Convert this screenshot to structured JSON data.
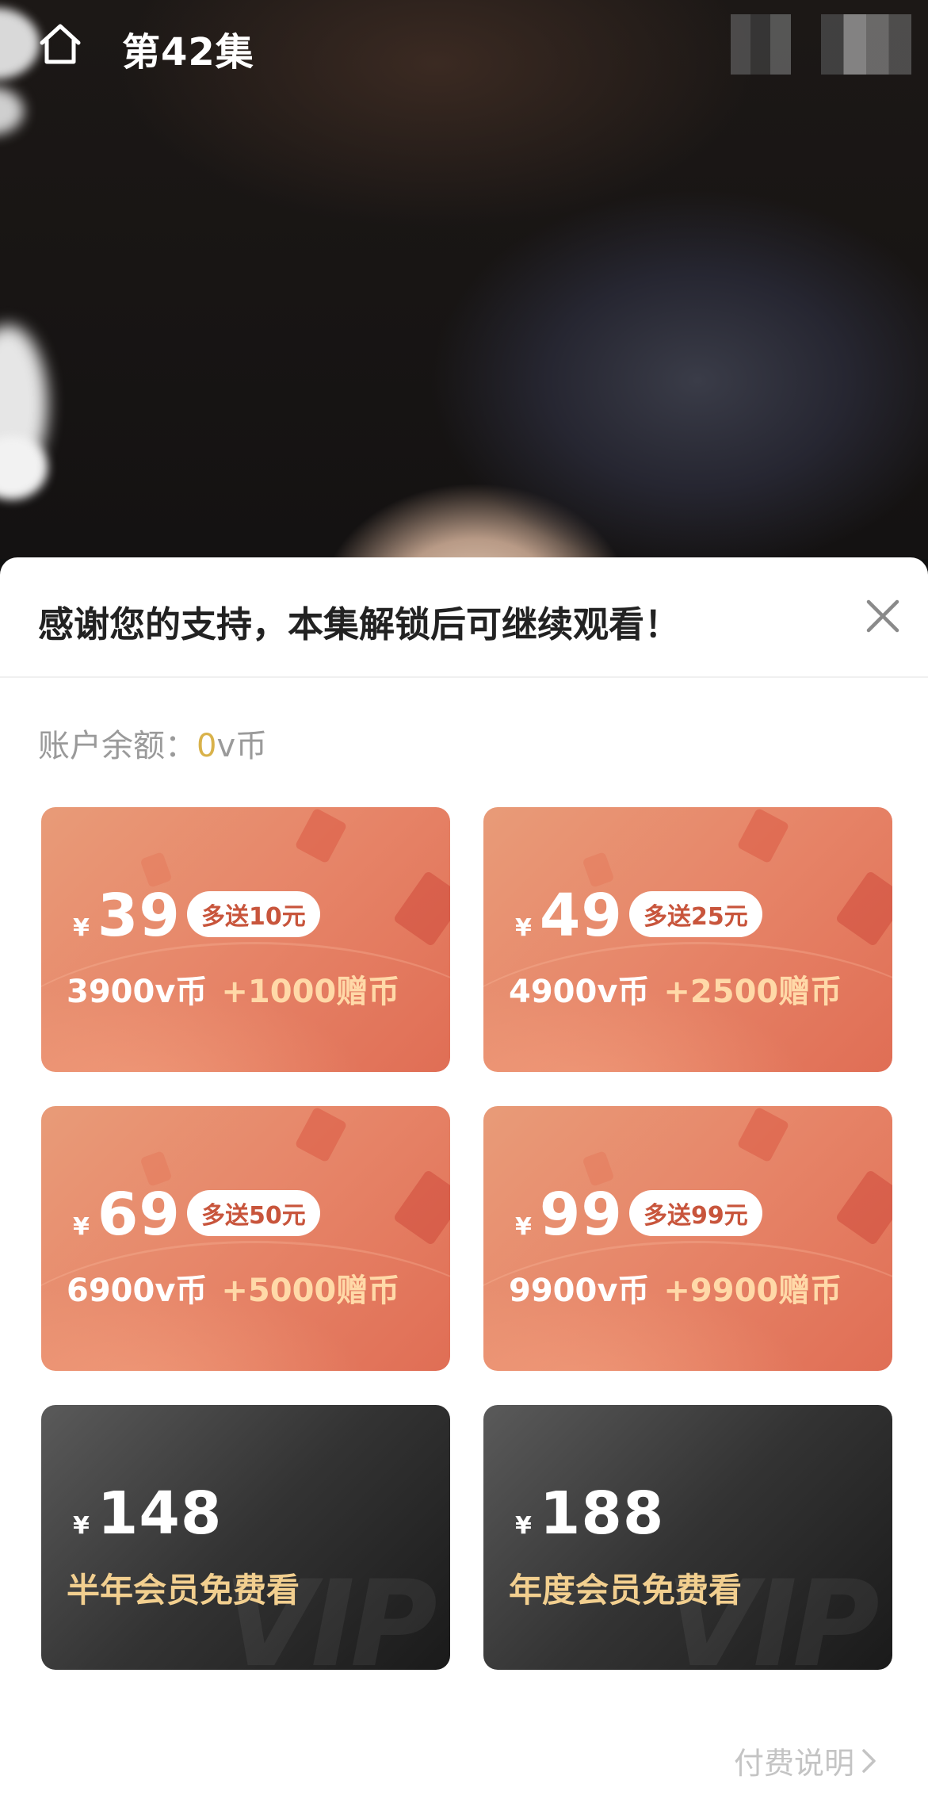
{
  "header": {
    "title": "第42集"
  },
  "sheet": {
    "title": "感谢您的支持，本集解锁后可继续观看！",
    "balance_label": "账户余额：",
    "balance_value": "0",
    "balance_unit": "v币",
    "pay_note": "付费说明"
  },
  "packages": [
    {
      "currency": "¥",
      "price": "39",
      "badge": "多送10元",
      "coins": "3900v币",
      "bonus": "+1000赠币"
    },
    {
      "currency": "¥",
      "price": "49",
      "badge": "多送25元",
      "coins": "4900v币",
      "bonus": "+2500赠币"
    },
    {
      "currency": "¥",
      "price": "69",
      "badge": "多送50元",
      "coins": "6900v币",
      "bonus": "+5000赠币"
    },
    {
      "currency": "¥",
      "price": "99",
      "badge": "多送99元",
      "coins": "9900v币",
      "bonus": "+9900赠币"
    }
  ],
  "vip": [
    {
      "currency": "¥",
      "price": "148",
      "label": "半年会员免费看",
      "watermark": "VIP"
    },
    {
      "currency": "¥",
      "price": "188",
      "label": "年度会员免费看",
      "watermark": "VIP"
    }
  ],
  "colors": {
    "accent_orange": "#e7876a",
    "gold_text": "#f2cf8f",
    "balance_highlight": "#d9b24a"
  }
}
